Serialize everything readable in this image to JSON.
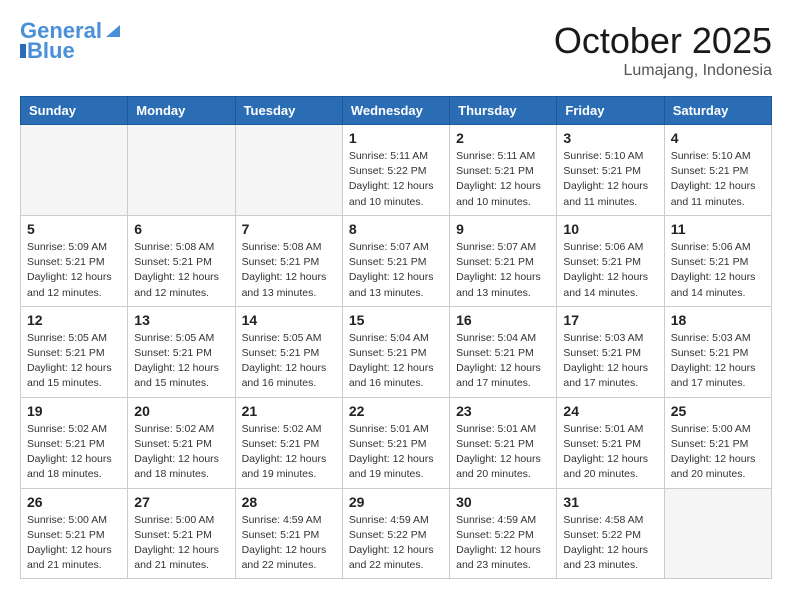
{
  "logo": {
    "text1": "General",
    "text2": "Blue"
  },
  "title": "October 2025",
  "location": "Lumajang, Indonesia",
  "days_of_week": [
    "Sunday",
    "Monday",
    "Tuesday",
    "Wednesday",
    "Thursday",
    "Friday",
    "Saturday"
  ],
  "weeks": [
    [
      {
        "day": "",
        "info": ""
      },
      {
        "day": "",
        "info": ""
      },
      {
        "day": "",
        "info": ""
      },
      {
        "day": "1",
        "info": "Sunrise: 5:11 AM\nSunset: 5:22 PM\nDaylight: 12 hours\nand 10 minutes."
      },
      {
        "day": "2",
        "info": "Sunrise: 5:11 AM\nSunset: 5:21 PM\nDaylight: 12 hours\nand 10 minutes."
      },
      {
        "day": "3",
        "info": "Sunrise: 5:10 AM\nSunset: 5:21 PM\nDaylight: 12 hours\nand 11 minutes."
      },
      {
        "day": "4",
        "info": "Sunrise: 5:10 AM\nSunset: 5:21 PM\nDaylight: 12 hours\nand 11 minutes."
      }
    ],
    [
      {
        "day": "5",
        "info": "Sunrise: 5:09 AM\nSunset: 5:21 PM\nDaylight: 12 hours\nand 12 minutes."
      },
      {
        "day": "6",
        "info": "Sunrise: 5:08 AM\nSunset: 5:21 PM\nDaylight: 12 hours\nand 12 minutes."
      },
      {
        "day": "7",
        "info": "Sunrise: 5:08 AM\nSunset: 5:21 PM\nDaylight: 12 hours\nand 13 minutes."
      },
      {
        "day": "8",
        "info": "Sunrise: 5:07 AM\nSunset: 5:21 PM\nDaylight: 12 hours\nand 13 minutes."
      },
      {
        "day": "9",
        "info": "Sunrise: 5:07 AM\nSunset: 5:21 PM\nDaylight: 12 hours\nand 13 minutes."
      },
      {
        "day": "10",
        "info": "Sunrise: 5:06 AM\nSunset: 5:21 PM\nDaylight: 12 hours\nand 14 minutes."
      },
      {
        "day": "11",
        "info": "Sunrise: 5:06 AM\nSunset: 5:21 PM\nDaylight: 12 hours\nand 14 minutes."
      }
    ],
    [
      {
        "day": "12",
        "info": "Sunrise: 5:05 AM\nSunset: 5:21 PM\nDaylight: 12 hours\nand 15 minutes."
      },
      {
        "day": "13",
        "info": "Sunrise: 5:05 AM\nSunset: 5:21 PM\nDaylight: 12 hours\nand 15 minutes."
      },
      {
        "day": "14",
        "info": "Sunrise: 5:05 AM\nSunset: 5:21 PM\nDaylight: 12 hours\nand 16 minutes."
      },
      {
        "day": "15",
        "info": "Sunrise: 5:04 AM\nSunset: 5:21 PM\nDaylight: 12 hours\nand 16 minutes."
      },
      {
        "day": "16",
        "info": "Sunrise: 5:04 AM\nSunset: 5:21 PM\nDaylight: 12 hours\nand 17 minutes."
      },
      {
        "day": "17",
        "info": "Sunrise: 5:03 AM\nSunset: 5:21 PM\nDaylight: 12 hours\nand 17 minutes."
      },
      {
        "day": "18",
        "info": "Sunrise: 5:03 AM\nSunset: 5:21 PM\nDaylight: 12 hours\nand 17 minutes."
      }
    ],
    [
      {
        "day": "19",
        "info": "Sunrise: 5:02 AM\nSunset: 5:21 PM\nDaylight: 12 hours\nand 18 minutes."
      },
      {
        "day": "20",
        "info": "Sunrise: 5:02 AM\nSunset: 5:21 PM\nDaylight: 12 hours\nand 18 minutes."
      },
      {
        "day": "21",
        "info": "Sunrise: 5:02 AM\nSunset: 5:21 PM\nDaylight: 12 hours\nand 19 minutes."
      },
      {
        "day": "22",
        "info": "Sunrise: 5:01 AM\nSunset: 5:21 PM\nDaylight: 12 hours\nand 19 minutes."
      },
      {
        "day": "23",
        "info": "Sunrise: 5:01 AM\nSunset: 5:21 PM\nDaylight: 12 hours\nand 20 minutes."
      },
      {
        "day": "24",
        "info": "Sunrise: 5:01 AM\nSunset: 5:21 PM\nDaylight: 12 hours\nand 20 minutes."
      },
      {
        "day": "25",
        "info": "Sunrise: 5:00 AM\nSunset: 5:21 PM\nDaylight: 12 hours\nand 20 minutes."
      }
    ],
    [
      {
        "day": "26",
        "info": "Sunrise: 5:00 AM\nSunset: 5:21 PM\nDaylight: 12 hours\nand 21 minutes."
      },
      {
        "day": "27",
        "info": "Sunrise: 5:00 AM\nSunset: 5:21 PM\nDaylight: 12 hours\nand 21 minutes."
      },
      {
        "day": "28",
        "info": "Sunrise: 4:59 AM\nSunset: 5:21 PM\nDaylight: 12 hours\nand 22 minutes."
      },
      {
        "day": "29",
        "info": "Sunrise: 4:59 AM\nSunset: 5:22 PM\nDaylight: 12 hours\nand 22 minutes."
      },
      {
        "day": "30",
        "info": "Sunrise: 4:59 AM\nSunset: 5:22 PM\nDaylight: 12 hours\nand 23 minutes."
      },
      {
        "day": "31",
        "info": "Sunrise: 4:58 AM\nSunset: 5:22 PM\nDaylight: 12 hours\nand 23 minutes."
      },
      {
        "day": "",
        "info": ""
      }
    ]
  ]
}
